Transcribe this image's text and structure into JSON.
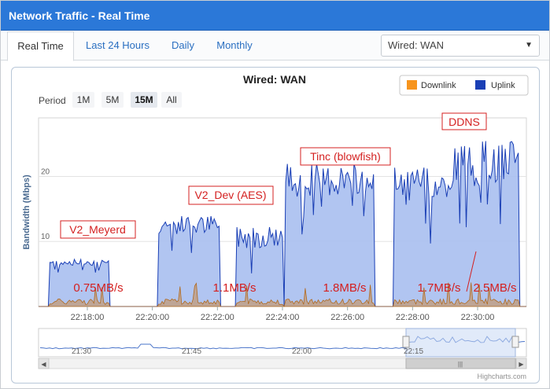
{
  "window": {
    "title": "Network Traffic - Real Time"
  },
  "tabs": [
    {
      "label": "Real Time",
      "active": true
    },
    {
      "label": "Last 24 Hours",
      "active": false
    },
    {
      "label": "Daily",
      "active": false
    },
    {
      "label": "Monthly",
      "active": false
    }
  ],
  "interface_select": {
    "value": "Wired: WAN"
  },
  "period": {
    "label": "Period",
    "options": [
      "1M",
      "5M",
      "15M",
      "All"
    ],
    "selected": "15M"
  },
  "legend": [
    {
      "name": "Downlink",
      "color": "#f7941d"
    },
    {
      "name": "Uplink",
      "color": "#1a3fb5"
    }
  ],
  "annotations": [
    {
      "text": "V2_Meyerd"
    },
    {
      "text": "V2_Dev (AES)"
    },
    {
      "text": "Tinc (blowfish)"
    },
    {
      "text": "DDNS"
    },
    {
      "text": "0.75MB/s"
    },
    {
      "text": "1.1MB/s"
    },
    {
      "text": "1.8MB/s"
    },
    {
      "text": "1.7MB/s"
    },
    {
      "text": "2.5MB/s"
    }
  ],
  "navigator": {
    "ticks": [
      "21:30",
      "21:45",
      "22:00",
      "22:15"
    ]
  },
  "credits": "Highcharts.com",
  "colors": {
    "accent": "#2b78d8",
    "uplink_fill": "#a9bff0",
    "uplink_line": "#1a3fb5",
    "downlink": "#c07a2a",
    "annotation": "#d42020"
  },
  "chart_data": {
    "type": "area",
    "title": "Wired: WAN",
    "xlabel": "",
    "ylabel": "Bandwidth (Mbps)",
    "ylim": [
      0,
      29
    ],
    "xlim": [
      "22:16:30",
      "22:31:30"
    ],
    "x_ticks": [
      "22:18:00",
      "22:20:00",
      "22:22:00",
      "22:24:00",
      "22:26:00",
      "22:28:00",
      "22:30:00"
    ],
    "y_ticks": [
      10,
      20
    ],
    "grid": true,
    "legend_position": "top-right",
    "segments": [
      {
        "start": "22:16:50",
        "end": "22:18:40",
        "level": 6.8,
        "noise": 0.5
      },
      {
        "start": "22:20:10",
        "end": "22:22:05",
        "level": 12.5,
        "noise": 1.5
      },
      {
        "start": "22:22:35",
        "end": "22:24:00",
        "level": 10.8,
        "noise": 1.8
      },
      {
        "start": "22:24:05",
        "end": "22:25:30",
        "level": 19.5,
        "noise": 2.6
      },
      {
        "start": "22:25:30",
        "end": "22:26:50",
        "level": 19.5,
        "noise": 2.6
      },
      {
        "start": "22:27:25",
        "end": "22:29:15",
        "level": 18.5,
        "noise": 3.0
      },
      {
        "start": "22:29:15",
        "end": "22:31:15",
        "level": 22.0,
        "noise": 3.5
      }
    ],
    "series": [
      {
        "name": "Downlink",
        "level": 0.6
      },
      {
        "name": "Uplink",
        "level": "segments"
      }
    ]
  }
}
